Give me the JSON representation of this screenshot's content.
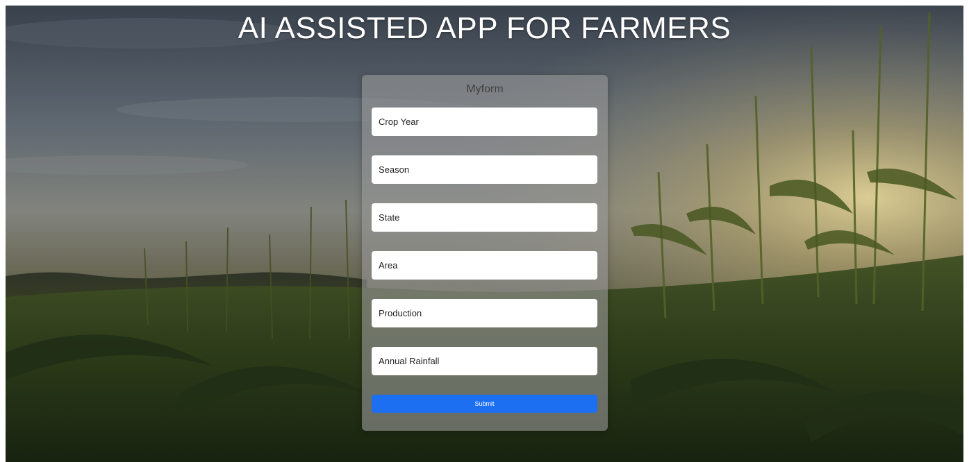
{
  "header": {
    "title": "AI ASSISTED APP FOR FARMERS"
  },
  "form": {
    "title": "Myform",
    "fields": [
      {
        "placeholder": "Crop Year",
        "value": ""
      },
      {
        "placeholder": "Season",
        "value": ""
      },
      {
        "placeholder": "State",
        "value": ""
      },
      {
        "placeholder": "Area",
        "value": ""
      },
      {
        "placeholder": "Production",
        "value": ""
      },
      {
        "placeholder": "Annual Rainfall",
        "value": ""
      }
    ],
    "submit_label": "Submit"
  },
  "colors": {
    "submit_button": "#1d6ff2",
    "form_background": "#969696",
    "title_text": "#ffffff"
  }
}
